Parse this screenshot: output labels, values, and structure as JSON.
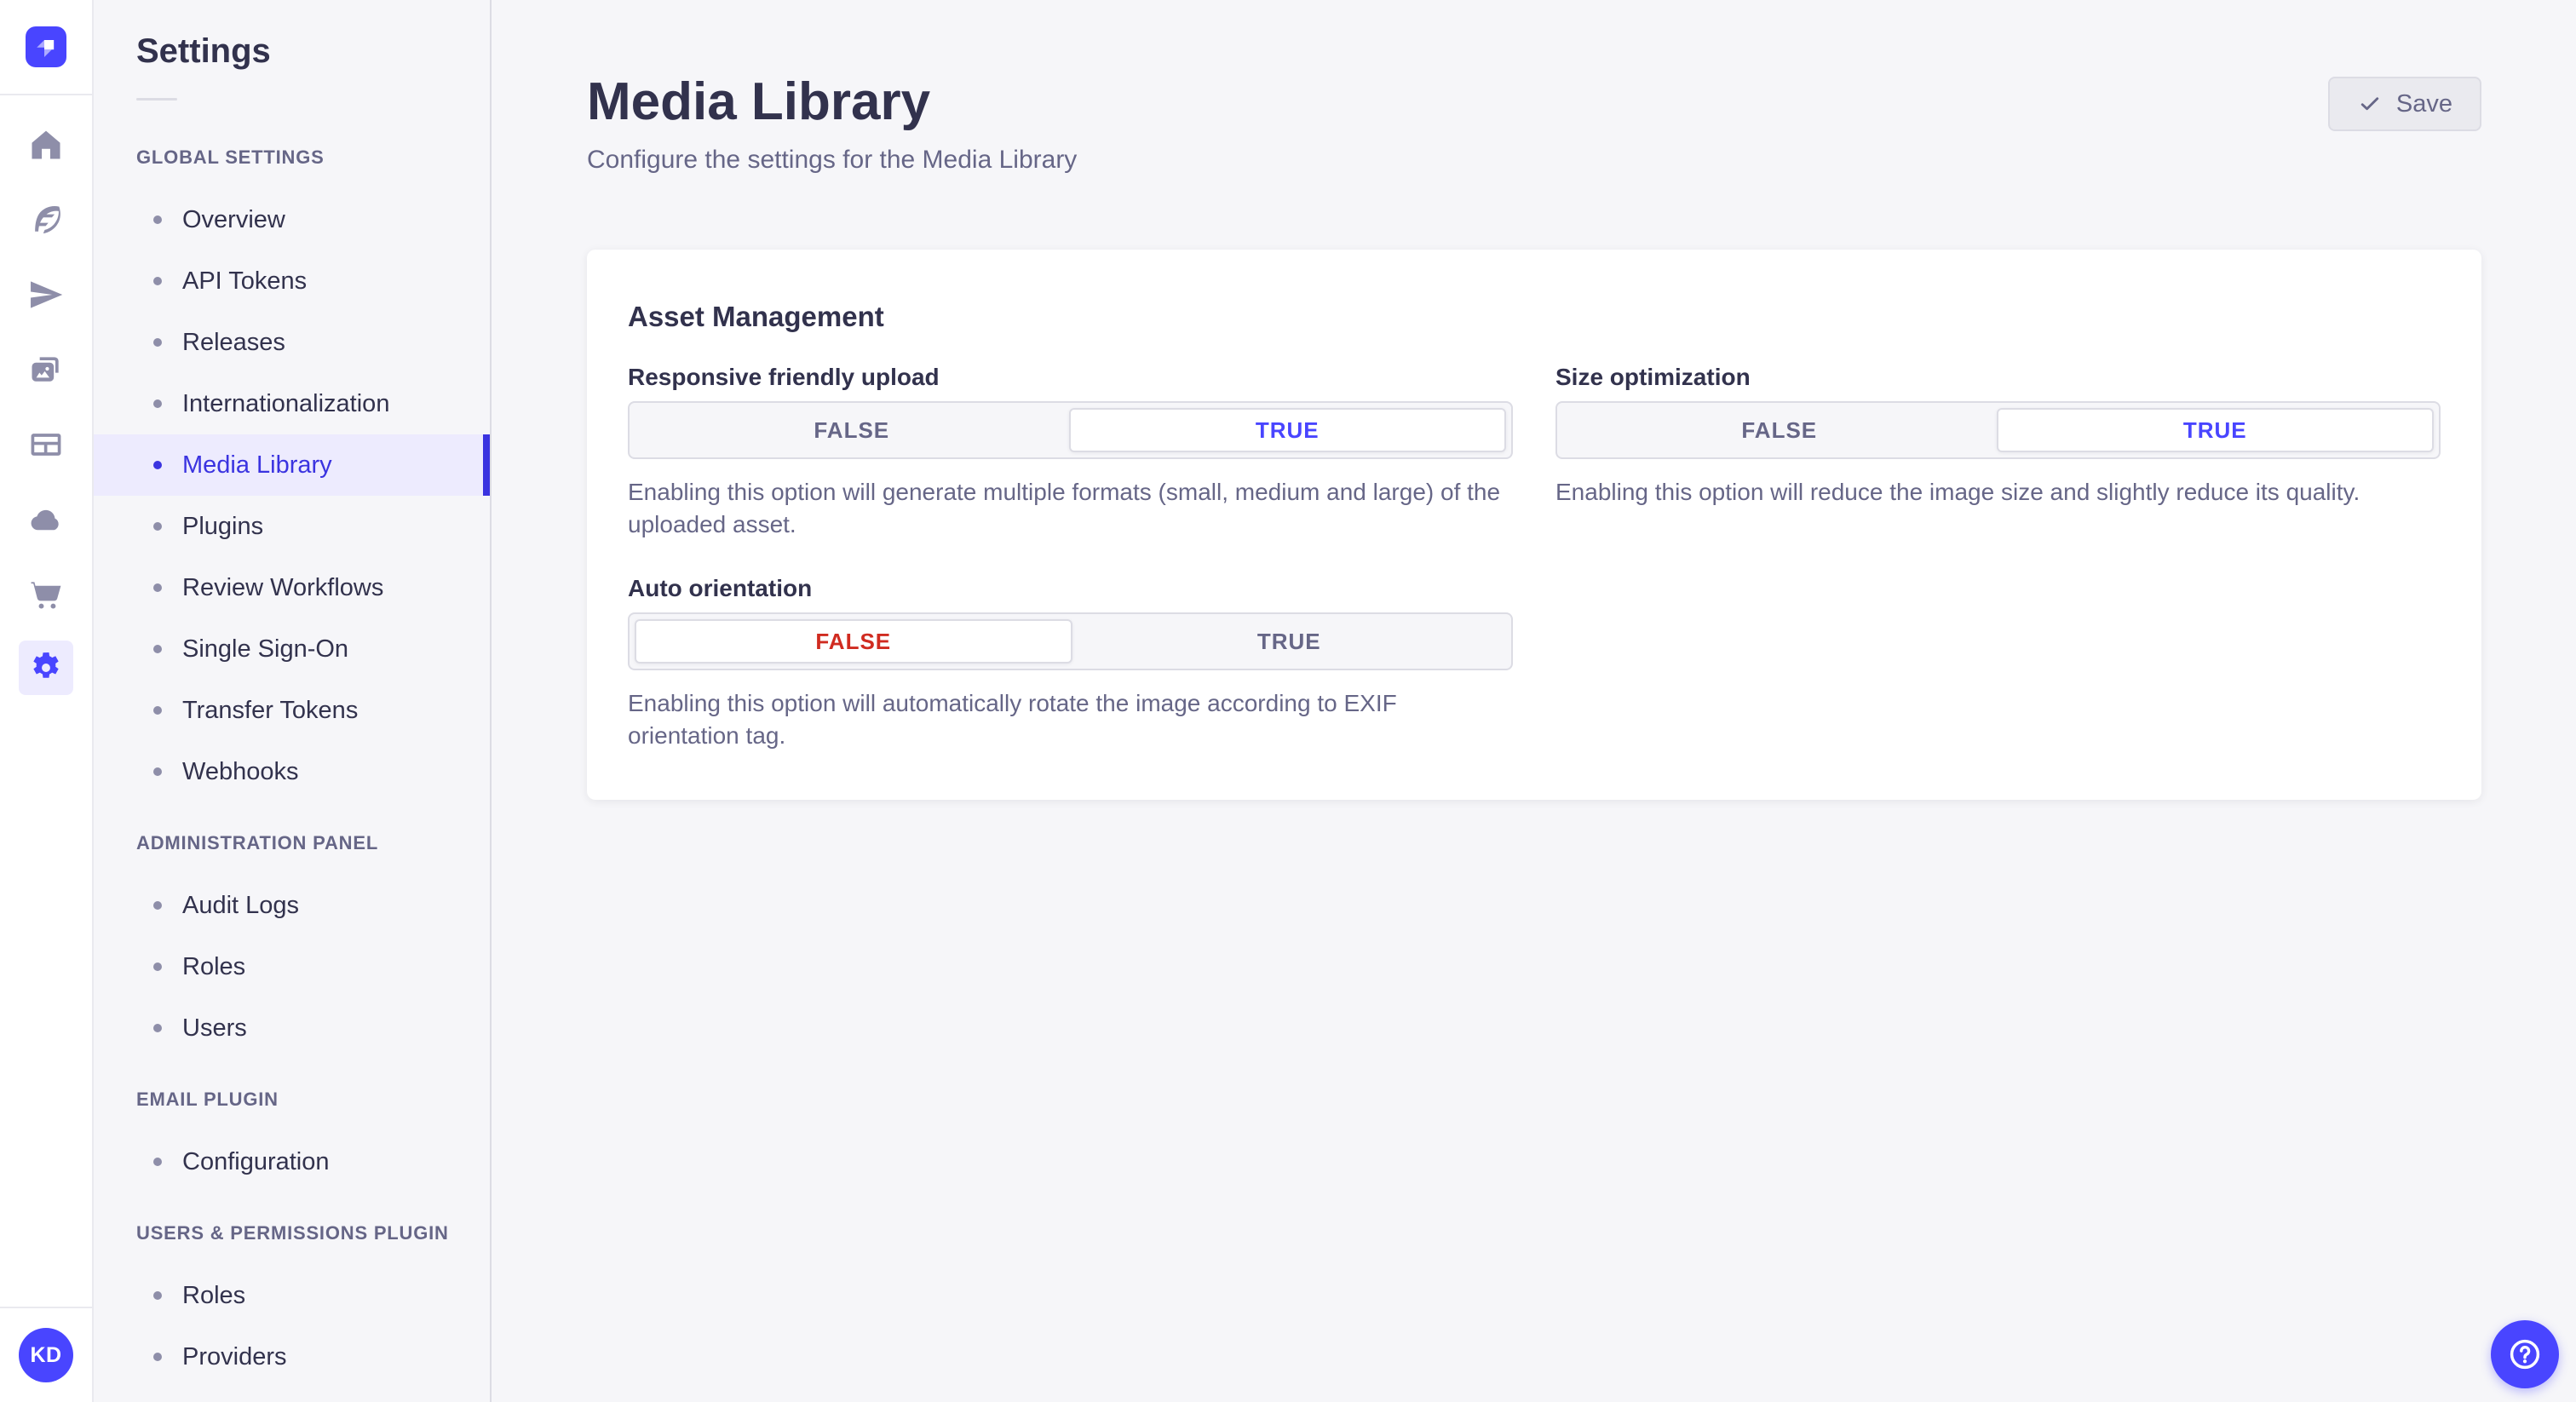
{
  "brand": {
    "logo_icon": "strapi-logo"
  },
  "rail": {
    "items": [
      {
        "icon": "home-icon",
        "active": false
      },
      {
        "icon": "feather-icon",
        "active": false
      },
      {
        "icon": "paper-plane-icon",
        "active": false
      },
      {
        "icon": "media-icon",
        "active": false
      },
      {
        "icon": "layout-icon",
        "active": false
      },
      {
        "icon": "cloud-icon",
        "active": false
      },
      {
        "icon": "cart-icon",
        "active": false
      },
      {
        "icon": "gear-icon",
        "active": true
      }
    ],
    "avatar_initials": "KD"
  },
  "subnav": {
    "title": "Settings",
    "sections": [
      {
        "label": "GLOBAL SETTINGS",
        "items": [
          {
            "label": "Overview",
            "active": false
          },
          {
            "label": "API Tokens",
            "active": false
          },
          {
            "label": "Releases",
            "active": false
          },
          {
            "label": "Internationalization",
            "active": false
          },
          {
            "label": "Media Library",
            "active": true
          },
          {
            "label": "Plugins",
            "active": false
          },
          {
            "label": "Review Workflows",
            "active": false
          },
          {
            "label": "Single Sign-On",
            "active": false
          },
          {
            "label": "Transfer Tokens",
            "active": false
          },
          {
            "label": "Webhooks",
            "active": false
          }
        ]
      },
      {
        "label": "ADMINISTRATION PANEL",
        "items": [
          {
            "label": "Audit Logs",
            "active": false
          },
          {
            "label": "Roles",
            "active": false
          },
          {
            "label": "Users",
            "active": false
          }
        ]
      },
      {
        "label": "EMAIL PLUGIN",
        "items": [
          {
            "label": "Configuration",
            "active": false
          }
        ]
      },
      {
        "label": "USERS & PERMISSIONS PLUGIN",
        "items": [
          {
            "label": "Roles",
            "active": false
          },
          {
            "label": "Providers",
            "active": false
          }
        ]
      }
    ]
  },
  "header": {
    "title": "Media Library",
    "subtitle": "Configure the settings for the Media Library",
    "save_label": "Save",
    "save_icon": "check-icon"
  },
  "card": {
    "section_title": "Asset Management",
    "fields": [
      {
        "label": "Responsive friendly upload",
        "options": [
          "FALSE",
          "TRUE"
        ],
        "selected": "TRUE",
        "selected_style": "primary",
        "hint": "Enabling this option will generate multiple formats (small, medium and large) of the uploaded asset."
      },
      {
        "label": "Size optimization",
        "options": [
          "FALSE",
          "TRUE"
        ],
        "selected": "TRUE",
        "selected_style": "primary",
        "hint": "Enabling this option will reduce the image size and slightly reduce its quality."
      },
      {
        "label": "Auto orientation",
        "options": [
          "FALSE",
          "TRUE"
        ],
        "selected": "FALSE",
        "selected_style": "danger",
        "hint": "Enabling this option will automatically rotate the image according to EXIF orientation tag."
      }
    ]
  },
  "fab": {
    "icon": "help-icon"
  },
  "colors": {
    "primary": "#4945FF",
    "primary_active": "#3A33E0",
    "primary_bg": "#EDEBFE",
    "danger": "#D02B20",
    "text_dark": "#32324D",
    "text_muted": "#666687",
    "border": "#DCDCE4",
    "border_light": "#EAEAEF",
    "bg": "#F6F6F9",
    "icon_muted": "#8E8EA9"
  }
}
